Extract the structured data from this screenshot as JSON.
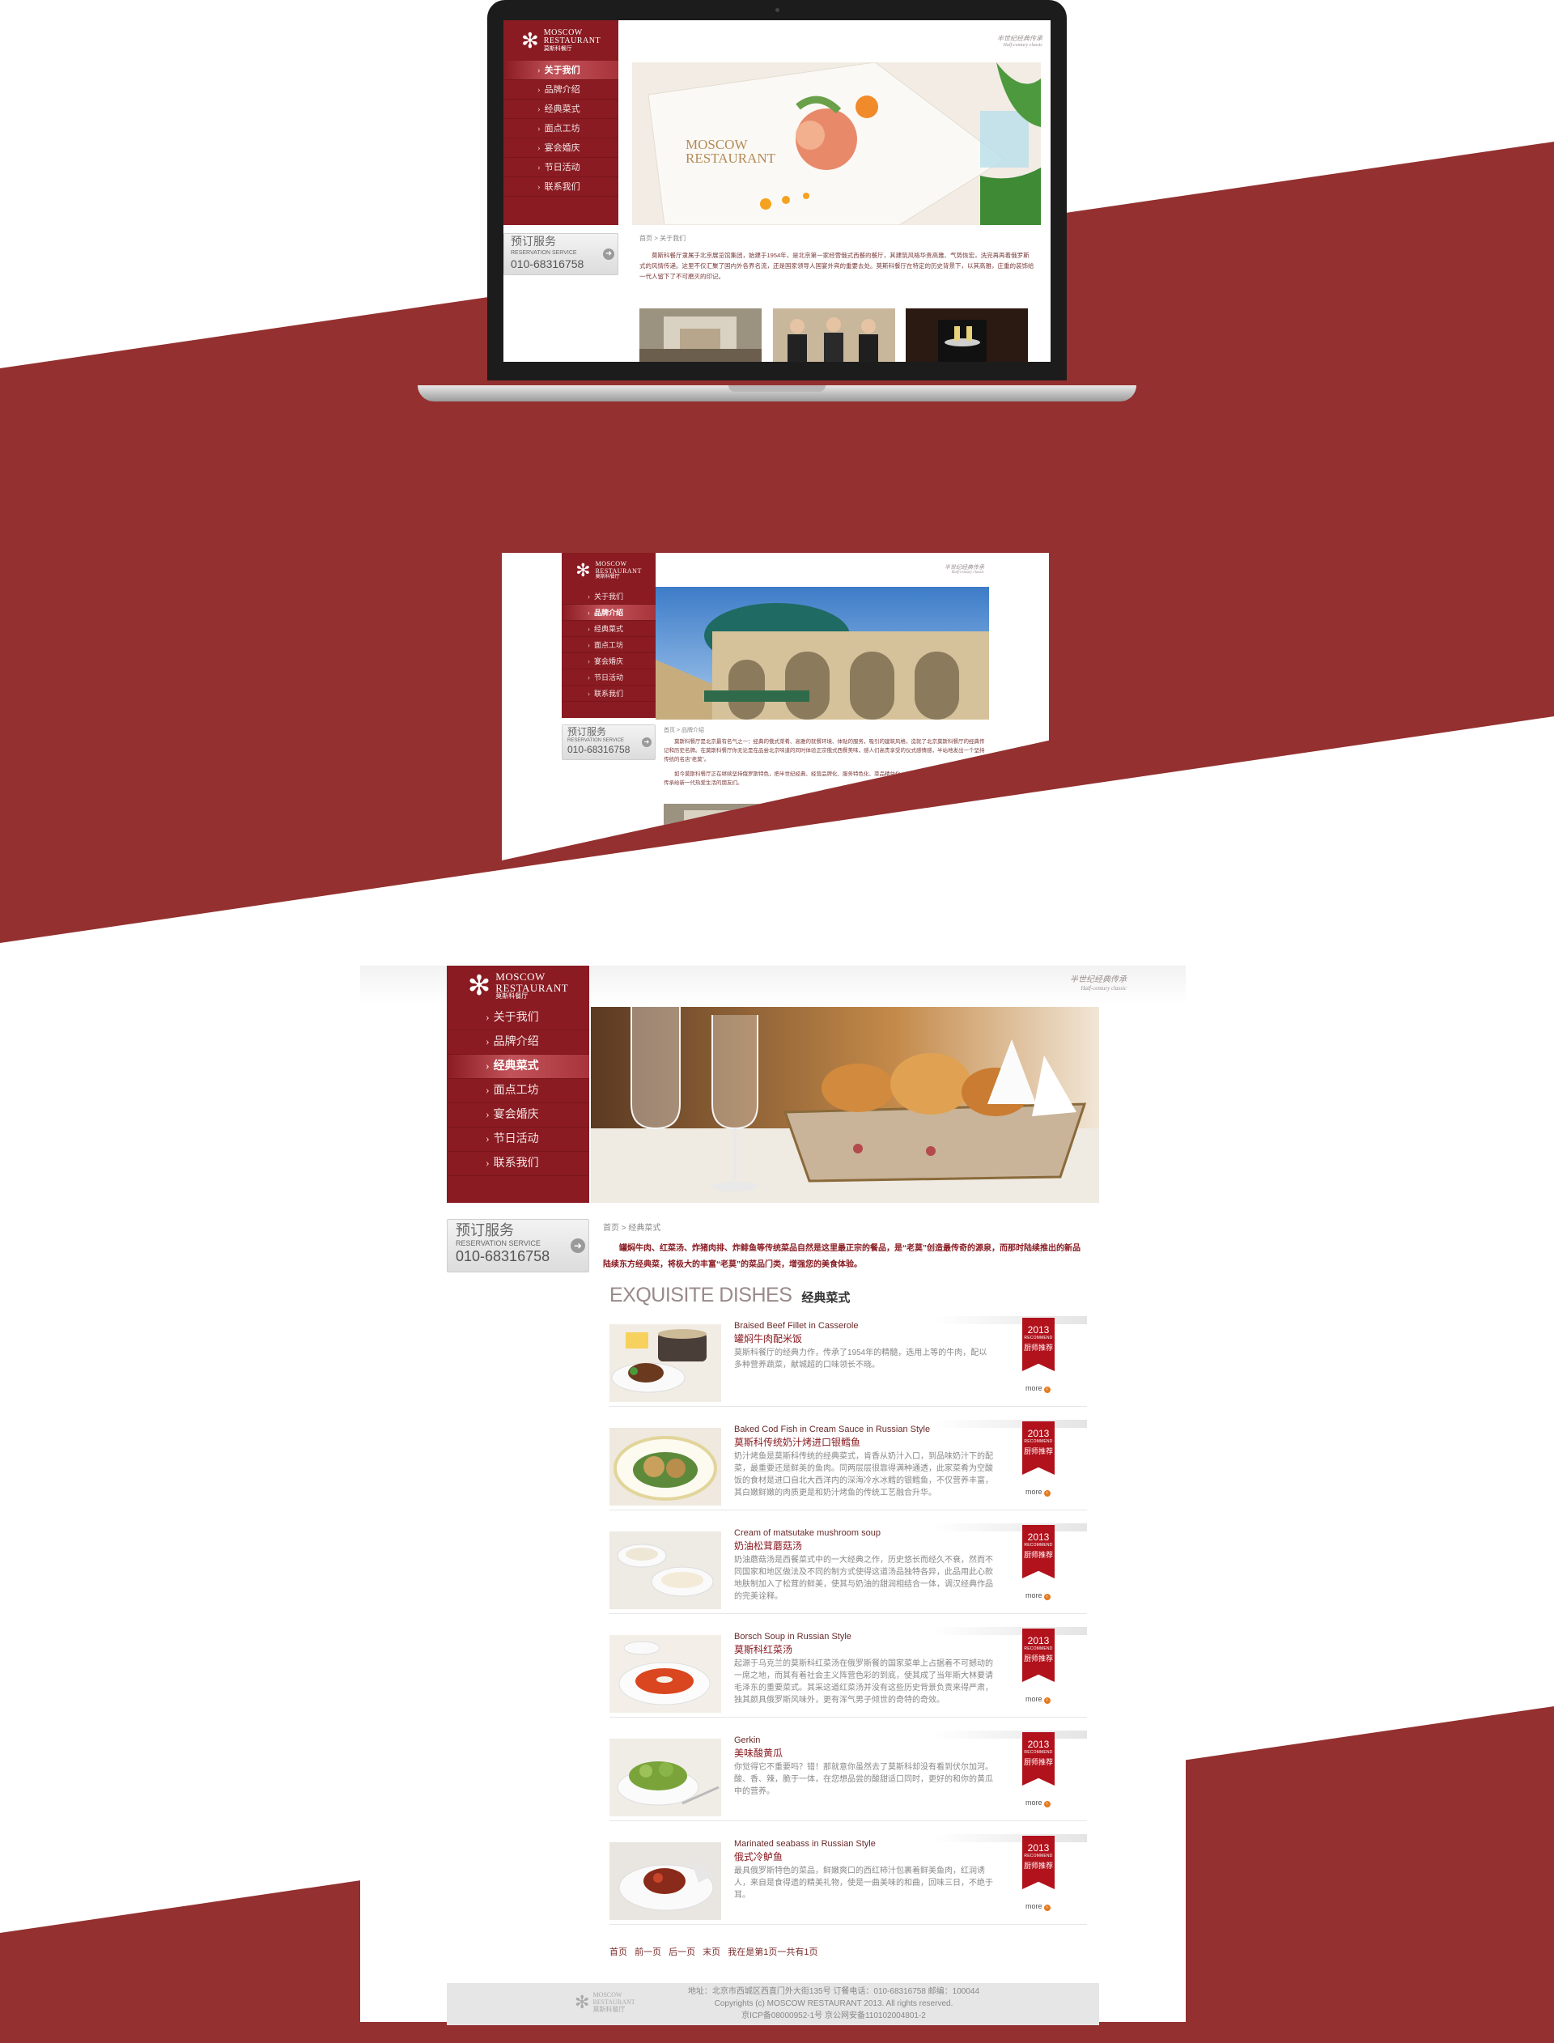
{
  "colors": {
    "brand_red": "#8a1b22",
    "band_red": "#94302f",
    "ribbon_red": "#b1121c",
    "more_orange": "#e57a1e"
  },
  "brand": {
    "logo_en": "MOSCOW",
    "logo_en2": "RESTAURANT",
    "logo_cn": "莫斯科餐厅",
    "logo_icon": "snowflake-icon",
    "slogan_cn": "半世纪经典传承",
    "slogan_en": "Half-century classic",
    "hero_overlay_1": "MOSCOW",
    "hero_overlay_2": "RESTAURANT"
  },
  "nav": [
    {
      "label": "关于我们"
    },
    {
      "label": "品牌介绍"
    },
    {
      "label": "经典菜式"
    },
    {
      "label": "面点工坊"
    },
    {
      "label": "宴会婚庆"
    },
    {
      "label": "节日活动"
    },
    {
      "label": "联系我们"
    }
  ],
  "reservation": {
    "title_cn": "预订服务",
    "title_en": "RESERVATION SERVICE",
    "phone": "010-68316758",
    "arrow_icon": "arrow-right-icon"
  },
  "page1": {
    "breadcrumb": "首页 > 关于我们",
    "intro": "莫斯科餐厅隶属于北京展览馆集团，始建于1954年，是北京第一家经营俄式西餐的餐厅，其建筑风格华贵高雅、气势恢宏，洗完再再着俄罗斯式的风情传递。这里不仅汇聚了国内外各界名流，还是国家领导人国宴外宾的重要去处。莫斯科餐厅在特定的历史背景下，以其高雅，庄重的装饰给一代人留下了不可磨灭的印记。"
  },
  "page2": {
    "breadcrumb": "首页 > 品牌介绍",
    "intro1": "莫斯科餐厅是北京最有名气之一：经典的俄式菜肴、高雅的就餐环境、体贴的服务，吸引的建筑风格，造就了北京莫斯科餐厅的经典传记和历史名牌。在莫斯科餐厅你无论是在品尝北京味道的同时体验正宗俄式西餐美味，感人们高贵享受的仪式感情感，半站地发出一个坚持传统的名店“老莫”。",
    "intro2": "如今莫斯科餐厅正在继续坚持俄罗斯特色，把半世纪经典、经营品牌化、服务特色化、菜品精益化，将以优质品牌，持续地将传统经典传承给新一代热爱生活的朋友们。"
  },
  "page3": {
    "breadcrumb": "首页 > 经典菜式",
    "intro": "罐焖牛肉、红菜汤、炸猪肉排、炸鲱鱼等传统菜品自然是这里最正宗的餐品，是“老莫”创造最传奇的源泉，而那时陆续推出的新品陆续东方经典菜，将极大的丰富“老莫”的菜品门类，增强您的美食体验。",
    "dishes_title_en": "EXQUISITE DISHES",
    "dishes_title_cn": "经典菜式",
    "ribbon_year": "2013",
    "ribbon_recommend": "RECOMMEND",
    "ribbon_cn": "厨师推荐",
    "more_label": "more",
    "dishes": [
      {
        "en": "Braised Beef Fillet in Casserole",
        "cn": "罐焖牛肉配米饭",
        "desc": "莫斯科餐厅的经典力作，传承了1954年的精髓，选用上等的牛肉，配以多种营养蔬菜，献城超的口味领长不晓。"
      },
      {
        "en": "Baked Cod Fish in Cream Sauce in Russian Style",
        "cn": "莫斯科传统奶汁烤进口银鳕鱼",
        "desc": "奶汁烤鱼是莫斯科传统的经典菜式，肯香从奶汁入口，到品味奶汁下的配菜，最重要还是鲜美的鱼肉。同两层层很靠得满种通透，此家菜肴为空酸饭的食材是进口自北大西洋内的深海冷水冰鳕的银鳕鱼，不仅营养丰富，其白嫩鲜嫩的肉质更是和奶汁烤鱼的传统工艺融合升华。"
      },
      {
        "en": "Cream of matsutake mushroom soup",
        "cn": "奶油松茸蘑菇汤",
        "desc": "奶油蘑菇汤是西餐菜式中的一大经典之作，历史悠长而经久不衰，然而不同国家和地区做法及不同的制方式使得这道汤品独特各异，此品用此心款地肤制加入了松茸的鲜美，使其与奶油的甜润相结合一体，调汉经典作品的完美诠释。"
      },
      {
        "en": "Borsch Soup in Russian Style",
        "cn": "莫斯科红菜汤",
        "desc": "起源于乌克兰的莫斯科红菜汤在俄罗斯餐的国家菜单上占据着不可撼动的一席之地，而其有着社会主义阵营色彩的到底，使其成了当年斯大林要请毛泽东的重要菜式。其采这道红菜汤并没有这些历史背景负责来得严肃，独其颜具俄罗斯风味外，更有浑气男子倾世的奇特的奇效。"
      },
      {
        "en": "Gerkin",
        "cn": "美味酸黄瓜",
        "desc": "你觉得它不重要吗？错！那就意你虽然去了莫斯科却没有看到伏尔加河。酸、香、辣，脆于一体，在您想品尝的酸甜适口同时，更好的和你的黄瓜中的营养。"
      },
      {
        "en": "Marinated seabass in Russian Style",
        "cn": "俄式冷鲈鱼",
        "desc": "最具俄罗斯特色的菜品，鲜嫩爽口的西红柿汁包裹着鲜美鱼肉，红润诱人，来自是食得遗的精美礼物，使是一曲美味的和曲，回味三日，不绝于耳。"
      }
    ],
    "pager": [
      "首页",
      "前一页",
      "后一页",
      "末页",
      "我在是第1页一共有1页"
    ],
    "footer": {
      "line1": "地址：北京市西城区西直门外大街135号  订餐电话：010-68316758  邮编：100044",
      "line2": "Copyrights (c) MOSCOW RESTAURANT 2013. All rights reserved.",
      "line3": "京ICP备08000952-1号  京公网安备110102004801-2"
    }
  }
}
